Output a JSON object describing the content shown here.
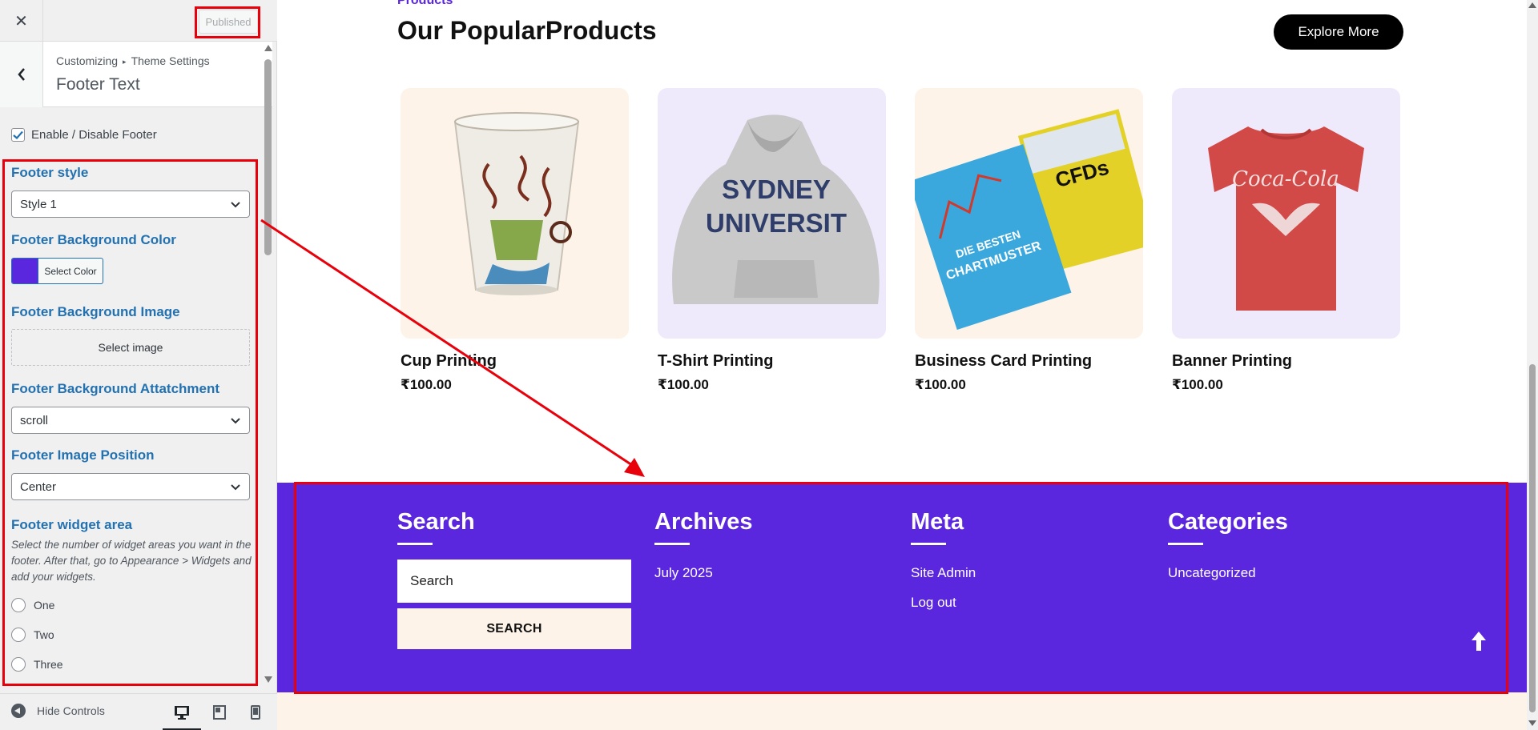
{
  "sidebar": {
    "close_glyph": "✕",
    "publish_label": "Published",
    "breadcrumb": {
      "root": "Customizing",
      "sep": "▸",
      "parent": "Theme Settings"
    },
    "section_title": "Footer Text",
    "enable_footer": {
      "label": "Enable / Disable Footer",
      "checked": true
    },
    "footer_style": {
      "label": "Footer style",
      "value": "Style 1"
    },
    "bg_color": {
      "label": "Footer Background Color",
      "button": "Select Color",
      "swatch": "#5b27de"
    },
    "bg_image": {
      "label": "Footer Background Image",
      "button": "Select image"
    },
    "bg_attachment": {
      "label": "Footer Background Attatchment",
      "value": "scroll"
    },
    "image_position": {
      "label": "Footer Image Position",
      "value": "Center"
    },
    "widget_area": {
      "label": "Footer widget area",
      "description": "Select the number of widget areas you want in the footer. After that, go to Appearance > Widgets and add your widgets.",
      "options": [
        "One",
        "Two",
        "Three"
      ]
    },
    "hide_controls": "Hide Controls",
    "devices": [
      "desktop-icon",
      "tablet-icon",
      "mobile-icon"
    ]
  },
  "preview": {
    "section_eyebrow": "Products",
    "section_title": "Our PopularProducts",
    "explore_label": "Explore More",
    "products": [
      {
        "name": "Cup Printing",
        "price": "₹100.00",
        "bg": "#fdf3e8"
      },
      {
        "name": "T-Shirt Printing",
        "price": "₹100.00",
        "bg": "#efe9fc"
      },
      {
        "name": "Business Card Printing",
        "price": "₹100.00",
        "bg": "#fdf3e8"
      },
      {
        "name": "Banner Printing",
        "price": "₹100.00",
        "bg": "#efe9fc"
      }
    ],
    "footer": {
      "bg": "#5b27de",
      "search": {
        "title": "Search",
        "placeholder": "Search",
        "button": "SEARCH"
      },
      "archives": {
        "title": "Archives",
        "items": [
          "July 2025"
        ]
      },
      "meta": {
        "title": "Meta",
        "items": [
          "Site Admin",
          "Log out"
        ]
      },
      "categories": {
        "title": "Categories",
        "items": [
          "Uncategorized"
        ]
      }
    }
  },
  "annotation_color": "#e8000b"
}
